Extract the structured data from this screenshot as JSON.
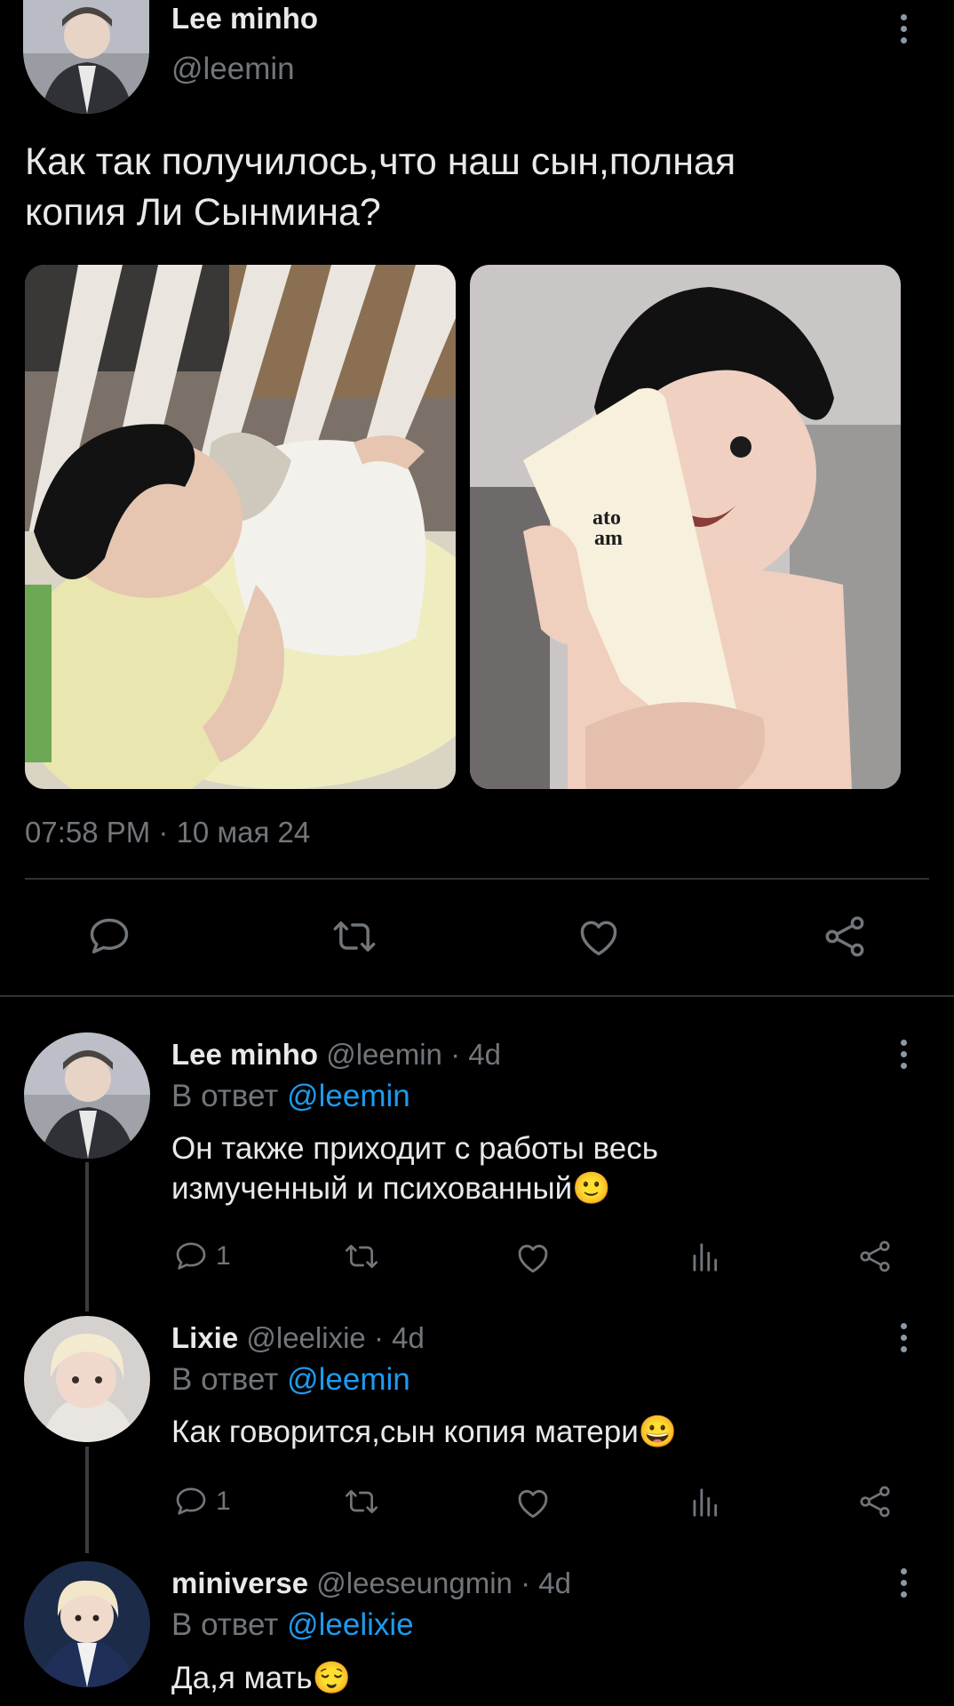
{
  "main_tweet": {
    "author_name": "Lee minho",
    "handle": "@leemin",
    "text_line1": "Как так получилось,что наш сын,полная",
    "text_line2": "копия Ли Сынмина?",
    "timestamp": "07:58 PM · 10 мая 24",
    "actions": [
      "reply-icon",
      "retweet-icon",
      "like-icon",
      "share-icon"
    ]
  },
  "replies": [
    {
      "name": "Lee minho",
      "handle": "@leemin",
      "time": "· 4d",
      "reply_prefix": "В ответ",
      "reply_to": "@leemin",
      "text_line1": "Он также приходит с работы весь",
      "text_line2": "измученный и психованный🙂",
      "reply_count": "1"
    },
    {
      "name": "Lixie",
      "handle": "@leelixie",
      "time": "· 4d",
      "reply_prefix": "В ответ",
      "reply_to": "@leemin",
      "text_line1": "Как говорится,сын копия матери😀",
      "reply_count": "1"
    },
    {
      "name": "miniverse",
      "handle": "@leeseungmin",
      "time": "· 4d",
      "reply_prefix": "В ответ",
      "reply_to": "@leelixie",
      "text_line1": "Да,я мать😌"
    }
  ],
  "colors": {
    "background": "#000000",
    "text": "#e7e9ea",
    "muted": "#71767b",
    "link": "#1d9bf0",
    "divider": "#2f3336"
  }
}
